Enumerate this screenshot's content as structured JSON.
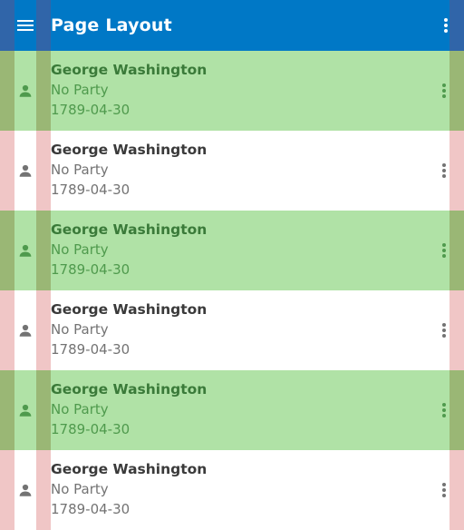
{
  "app_bar": {
    "title": "Page Layout",
    "menu_icon": "hamburger-menu-icon",
    "overflow_icon": "more-vert-icon",
    "color": "#0078c6"
  },
  "list": {
    "row_colors": {
      "highlight": "#b0e2a6",
      "normal": "#ffffff"
    },
    "items": [
      {
        "name": "George Washington",
        "party": "No Party",
        "date": "1789-04-30",
        "avatar_icon": "person-icon",
        "overflow_icon": "more-vert-icon"
      },
      {
        "name": "George Washington",
        "party": "No Party",
        "date": "1789-04-30",
        "avatar_icon": "person-icon",
        "overflow_icon": "more-vert-icon"
      },
      {
        "name": "George Washington",
        "party": "No Party",
        "date": "1789-04-30",
        "avatar_icon": "person-icon",
        "overflow_icon": "more-vert-icon"
      },
      {
        "name": "George Washington",
        "party": "No Party",
        "date": "1789-04-30",
        "avatar_icon": "person-icon",
        "overflow_icon": "more-vert-icon"
      },
      {
        "name": "George Washington",
        "party": "No Party",
        "date": "1789-04-30",
        "avatar_icon": "person-icon",
        "overflow_icon": "more-vert-icon"
      },
      {
        "name": "George Washington",
        "party": "No Party",
        "date": "1789-04-30",
        "avatar_icon": "person-icon",
        "overflow_icon": "more-vert-icon"
      }
    ]
  },
  "layout_guides": {
    "colors": {
      "appbar": "#4a5a9a",
      "highlight": "#8f9f5a",
      "normal": "#e8a8a8"
    }
  }
}
